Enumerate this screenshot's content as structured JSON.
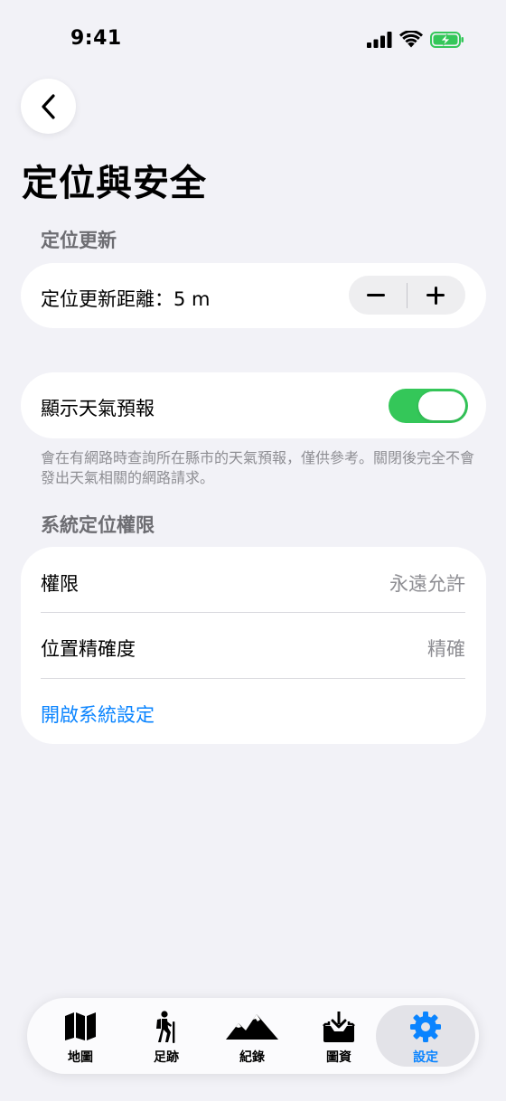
{
  "status_bar": {
    "time": "9:41"
  },
  "page": {
    "title": "定位與安全"
  },
  "location_update": {
    "header": "定位更新",
    "distance_label": "定位更新距離：5 m"
  },
  "weather": {
    "label": "顯示天氣預報",
    "enabled": true,
    "footnote": "會在有網路時查詢所在縣市的天氣預報，僅供參考。關閉後完全不會發出天氣相關的網路請求。"
  },
  "system_permission": {
    "header": "系統定位權限",
    "rows": [
      {
        "label": "權限",
        "value": "永遠允許"
      },
      {
        "label": "位置精確度",
        "value": "精確"
      }
    ],
    "open_settings_link": "開啟系統設定"
  },
  "tabbar": {
    "active_index": 4,
    "tabs": [
      {
        "label": "地圖",
        "icon": "map-icon"
      },
      {
        "label": "足跡",
        "icon": "hiker-icon"
      },
      {
        "label": "紀錄",
        "icon": "mountains-icon"
      },
      {
        "label": "圖資",
        "icon": "download-tray-icon"
      },
      {
        "label": "設定",
        "icon": "gear-icon"
      }
    ]
  },
  "colors": {
    "accent": "#0a84ff",
    "toggle_on": "#34c759",
    "background": "#f2f2f7",
    "secondary_text": "#8e8e93"
  }
}
